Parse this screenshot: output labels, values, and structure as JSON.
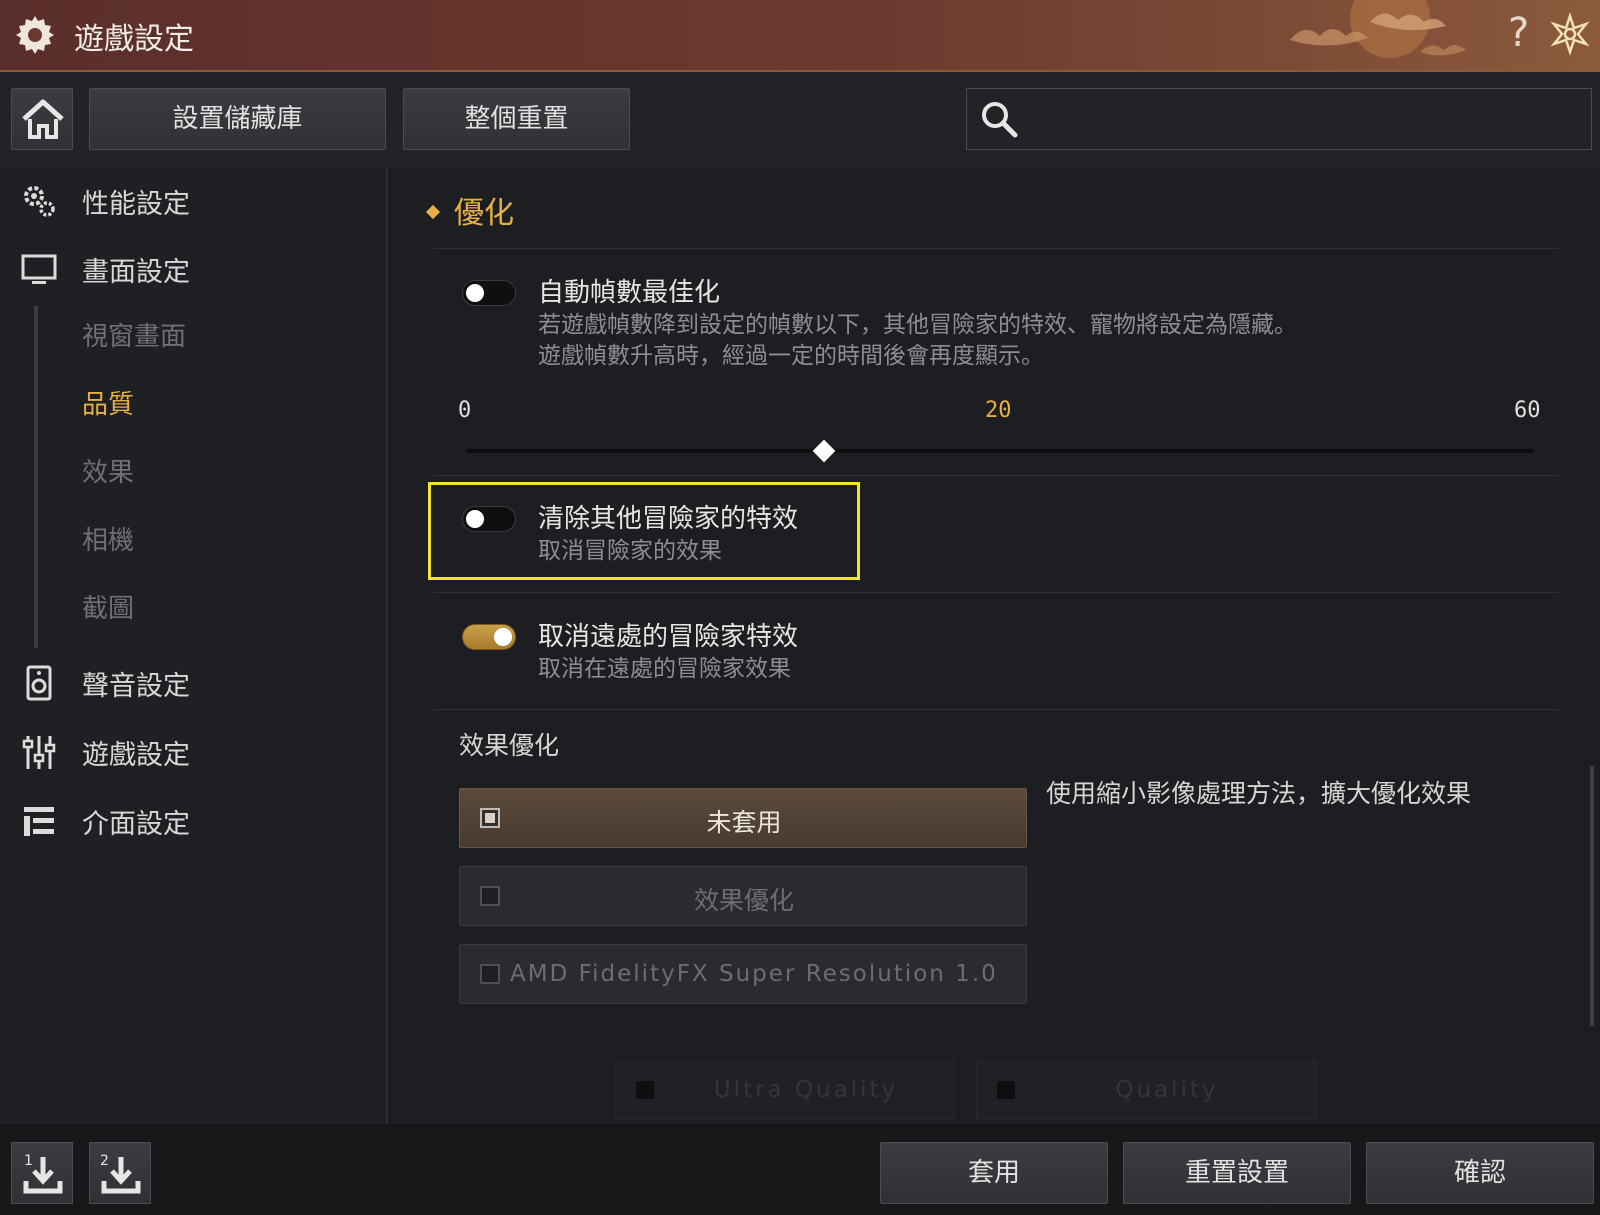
{
  "window": {
    "title": "遊戲設定",
    "help": "?"
  },
  "toolbar": {
    "storage_label": "設置儲藏庫",
    "reset_all_label": "整個重置",
    "search_placeholder": ""
  },
  "sidebar": {
    "items": [
      {
        "label": "性能設定"
      },
      {
        "label": "畫面設定"
      },
      {
        "label": "聲音設定"
      },
      {
        "label": "遊戲設定"
      },
      {
        "label": "介面設定"
      }
    ],
    "sub_items": [
      {
        "label": "視窗畫面"
      },
      {
        "label": "品質",
        "active": true
      },
      {
        "label": "效果"
      },
      {
        "label": "相機"
      },
      {
        "label": "截圖"
      }
    ]
  },
  "main": {
    "section_title": "優化",
    "auto_fps": {
      "title": "自動幀數最佳化",
      "desc1": "若遊戲幀數降到設定的幀數以下，其他冒險家的特效、寵物將設定為隱藏。",
      "desc2": "遊戲幀數升高時，經過一定的時間後會再度顯示。",
      "enabled": false,
      "slider": {
        "min": "0",
        "value": "20",
        "max": "60"
      }
    },
    "remove_effects": {
      "title": "清除其他冒險家的特效",
      "desc": "取消冒險家的效果",
      "enabled": false
    },
    "remove_far_effects": {
      "title": "取消遠處的冒險家特效",
      "desc": "取消在遠處的冒險家效果",
      "enabled": true
    },
    "effect_opt": {
      "heading": "效果優化",
      "choices": [
        {
          "label": "未套用",
          "selected": true
        },
        {
          "label": "效果優化",
          "selected": false
        },
        {
          "label": "AMD FidelityFX Super Resolution 1.0",
          "selected": false
        }
      ],
      "description": "使用縮小影像處理方法，擴大優化效果",
      "quality_options": [
        {
          "label": "Ultra Quality"
        },
        {
          "label": "Quality"
        }
      ]
    }
  },
  "bottom": {
    "apply": "套用",
    "reset": "重置設置",
    "confirm": "確認",
    "slot1": "1",
    "slot2": "2"
  },
  "colors": {
    "accent": "#e7b042",
    "highlight_box": "#f2e52c",
    "title_bar": "#6d3a30"
  }
}
